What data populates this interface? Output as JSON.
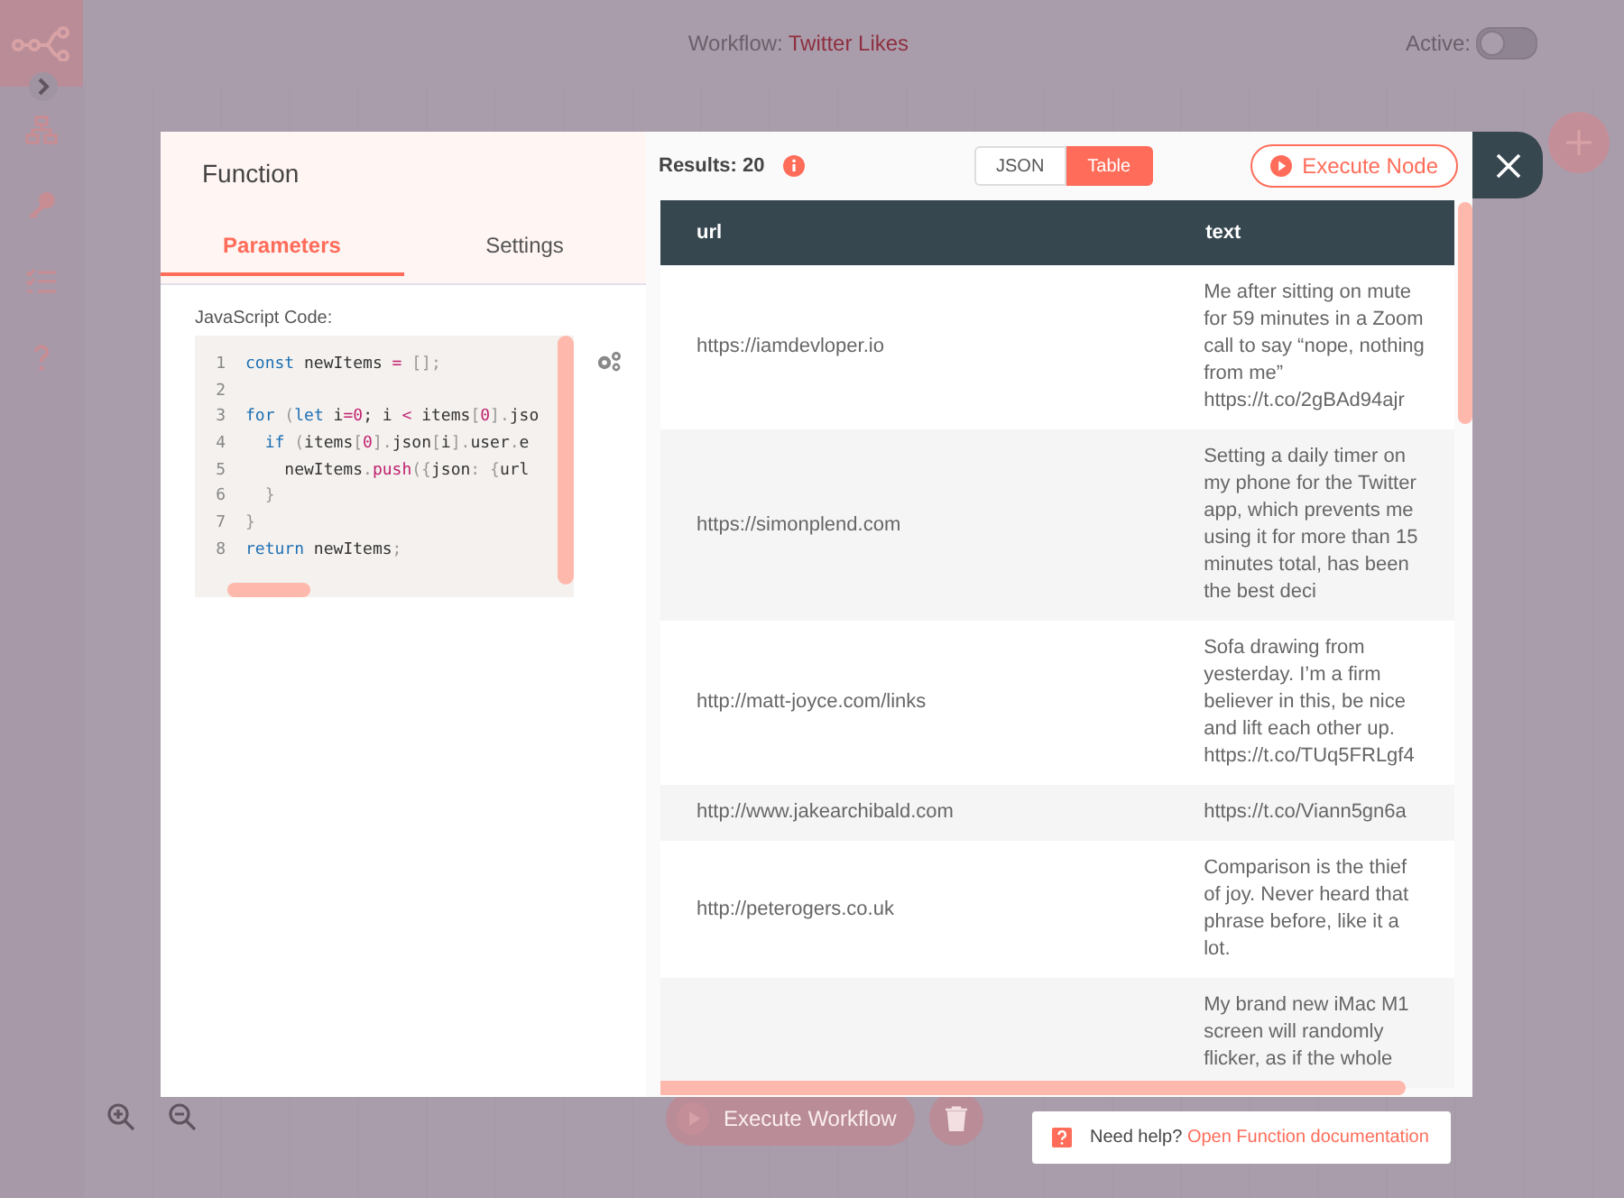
{
  "header": {
    "workflow_label": "Workflow:",
    "workflow_name": "Twitter Likes",
    "active_label": "Active:",
    "active_on": false
  },
  "modal": {
    "title": "Function",
    "tabs": [
      {
        "label": "Parameters",
        "selected": true
      },
      {
        "label": "Settings",
        "selected": false
      }
    ],
    "code_label": "JavaScript Code:",
    "code_lines": [
      {
        "number": "1",
        "tokens": [
          {
            "kind": "kw",
            "text": "const"
          },
          {
            "kind": "plain",
            "text": " newItems "
          },
          {
            "kind": "op",
            "text": "="
          },
          {
            "kind": "punct",
            "text": " []"
          },
          {
            "kind": "punct",
            "text": ";"
          }
        ]
      },
      {
        "number": "2"
      },
      {
        "number": "3",
        "tokens": [
          {
            "kind": "kw",
            "text": "for"
          },
          {
            "kind": "punct",
            "text": " ("
          },
          {
            "kind": "kw",
            "text": "let"
          },
          {
            "kind": "plain",
            "text": " i"
          },
          {
            "kind": "op",
            "text": "="
          },
          {
            "kind": "num",
            "text": "0"
          },
          {
            "kind": "plain",
            "text": "; i "
          },
          {
            "kind": "op",
            "text": "<"
          },
          {
            "kind": "plain",
            "text": " items"
          },
          {
            "kind": "punct",
            "text": "["
          },
          {
            "kind": "num",
            "text": "0"
          },
          {
            "kind": "punct",
            "text": "]."
          },
          {
            "kind": "plain",
            "text": "jso"
          }
        ]
      },
      {
        "number": "4",
        "tokens": [
          {
            "kind": "kw",
            "text": "  if"
          },
          {
            "kind": "punct",
            "text": " ("
          },
          {
            "kind": "plain",
            "text": "items"
          },
          {
            "kind": "punct",
            "text": "["
          },
          {
            "kind": "num",
            "text": "0"
          },
          {
            "kind": "punct",
            "text": "]."
          },
          {
            "kind": "plain",
            "text": "json"
          },
          {
            "kind": "punct",
            "text": "["
          },
          {
            "kind": "plain",
            "text": "i"
          },
          {
            "kind": "punct",
            "text": "]."
          },
          {
            "kind": "plain",
            "text": "user"
          },
          {
            "kind": "punct",
            "text": "."
          },
          {
            "kind": "plain",
            "text": "e"
          }
        ]
      },
      {
        "number": "5",
        "tokens": [
          {
            "kind": "plain",
            "text": "    newItems"
          },
          {
            "kind": "punct",
            "text": "."
          },
          {
            "kind": "fn",
            "text": "push"
          },
          {
            "kind": "punct",
            "text": "({"
          },
          {
            "kind": "plain",
            "text": "json"
          },
          {
            "kind": "punct",
            "text": ": {"
          },
          {
            "kind": "plain",
            "text": "url"
          }
        ]
      },
      {
        "number": "6",
        "tokens": [
          {
            "kind": "punct",
            "text": "  }"
          }
        ]
      },
      {
        "number": "7",
        "tokens": [
          {
            "kind": "punct",
            "text": "}"
          }
        ]
      },
      {
        "number": "8",
        "tokens": [
          {
            "kind": "kw",
            "text": "return"
          },
          {
            "kind": "plain",
            "text": " newItems"
          },
          {
            "kind": "punct",
            "text": ";"
          }
        ]
      }
    ],
    "results_label": "Results: 20",
    "views": [
      {
        "label": "JSON",
        "selected": false
      },
      {
        "label": "Table",
        "selected": true
      }
    ],
    "execute_label": "Execute Node",
    "table": {
      "columns": [
        "url",
        "text"
      ],
      "rows": [
        {
          "url": "https://iamdevloper.io",
          "text": "Me after sitting on mute for 59 minutes in a Zoom call to say “nope, nothing from me” https://t.co/2gBAd94ajr"
        },
        {
          "url": "https://simonplend.com",
          "text": "Setting a daily timer on my phone for the Twitter app, which prevents me using it for more than 15 minutes total, has been the best deci"
        },
        {
          "url": "http://matt-joyce.com/links",
          "text": "Sofa drawing from yesterday. I’m a firm believer in this, be nice and lift each other up. https://t.co/TUq5FRLgf4"
        },
        {
          "url": "http://www.jakearchibald.com",
          "text": "https://t.co/Viann5gn6a"
        },
        {
          "url": "http://peterogers.co.uk",
          "text": "Comparison is the thief of joy. Never heard that phrase before, like it a lot."
        },
        {
          "text": "My brand new iMac M1 screen will randomly flicker, as if the whole"
        }
      ]
    }
  },
  "bottom": {
    "execute_workflow": "Execute Workflow"
  },
  "help": {
    "text": "Need help?",
    "link": "Open Function documentation"
  }
}
